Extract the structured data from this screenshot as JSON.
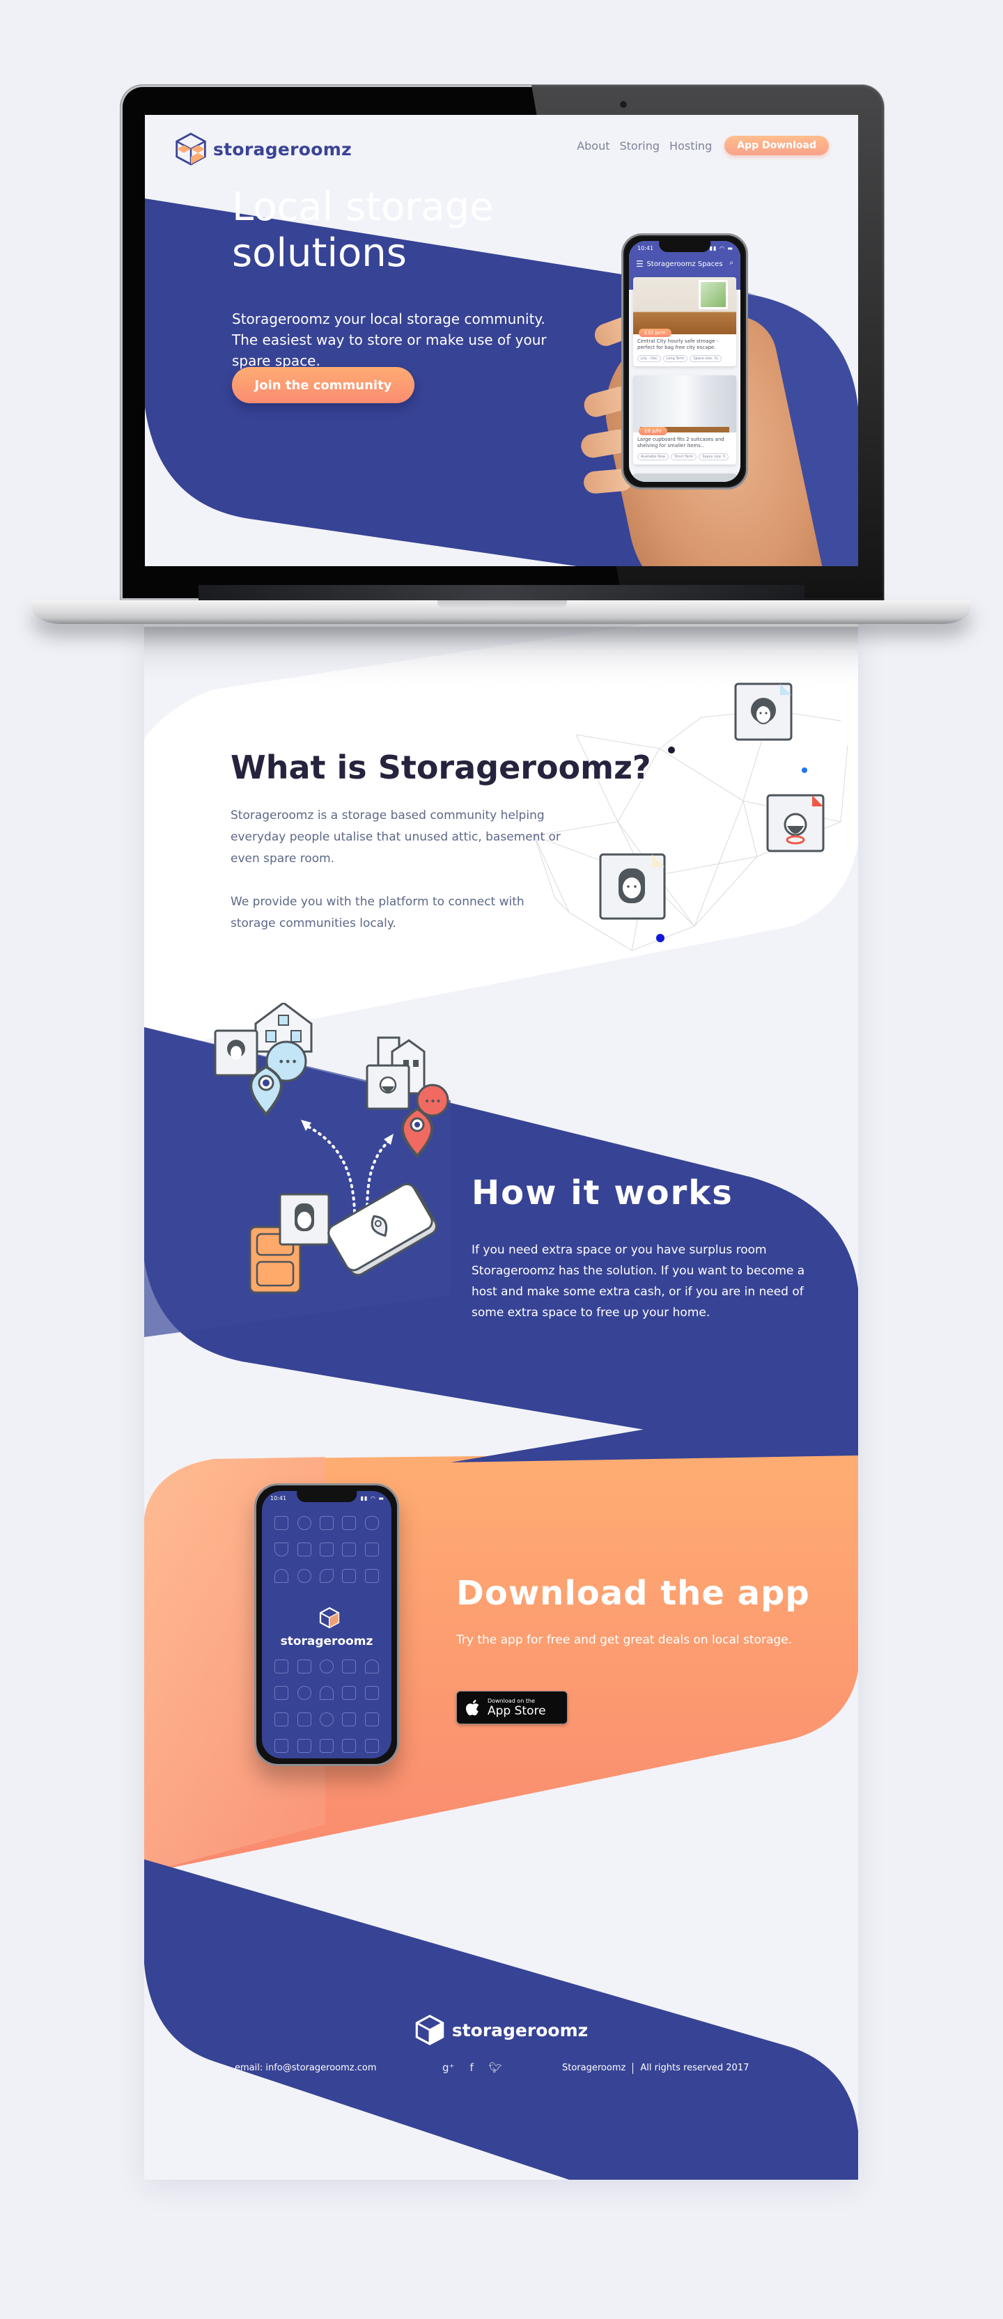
{
  "nav": {
    "brand": "storageroomz",
    "links": [
      "About",
      "Storing",
      "Hosting"
    ],
    "cta": "App Download"
  },
  "hero": {
    "title_line1": "Local storage",
    "title_line2": "solutions",
    "subtitle": "Storageroomz your local storage community. The easiest way to store or make use of your spare space.",
    "cta": "Join the community",
    "phone": {
      "time": "10:41",
      "app_title": "Storageroomz Spaces",
      "menu_icon": "hamburger-icon",
      "search_icon": "search-icon",
      "listings": [
        {
          "price": "£32 pcm",
          "description": "Central City hourly safe stroage - perfect for bag free city escape.",
          "tags": [
            "July - Dec",
            "Long Term",
            "Space size: XL"
          ]
        },
        {
          "price": "£8 p/hr",
          "description": "Large cupboard fits 2 suitcases and shelving for smaller items..",
          "tags": [
            "Available Now",
            "Short Term",
            "Space size: S"
          ]
        }
      ]
    }
  },
  "what": {
    "title": "What is Storageroomz?",
    "paragraph1": "Storageroomz is a storage based community helping everyday people utalise that unused attic, basement or even spare room.",
    "paragraph2": "We provide you with the platform to connect with storage communities localy."
  },
  "how": {
    "title": "How it works",
    "paragraph": "If you need extra space or you have surplus room Storageroomz has the solution. If you want to become a host and make some extra cash, or if you are in need of some extra space to free up your home."
  },
  "download": {
    "title": "Download the app",
    "paragraph": "Try the app for free and get great deals on local storage.",
    "appstore_line1": "Download on the",
    "appstore_line2": "App Store",
    "phone_time": "10:41",
    "phone_brand": "storageroomz"
  },
  "footer": {
    "brand": "storageroomz",
    "email": "email: info@storageroomz.com",
    "social": [
      "google-plus-icon",
      "facebook-icon",
      "twitter-icon"
    ],
    "company": "Storageroomz",
    "rights": "All rights reserved 2017"
  },
  "colors": {
    "brand_blue": "#374394",
    "accent_orange": "#ffac73",
    "accent_coral": "#f98c71",
    "background": "#f2f3f8",
    "heading_dark": "#25233d",
    "body_gray": "#5d6887"
  }
}
